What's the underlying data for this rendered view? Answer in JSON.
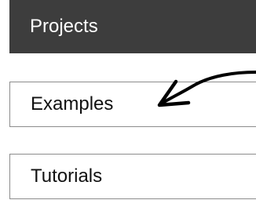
{
  "header": {
    "title": "Projects"
  },
  "items": [
    {
      "label": "Examples"
    },
    {
      "label": "Tutorials"
    }
  ],
  "colors": {
    "header_bg": "#3d3d3d",
    "header_text": "#ffffff",
    "item_border": "#8c8c8c",
    "arrow": "#000000"
  },
  "icons": {
    "annotation": "hand-drawn-arrow-icon"
  }
}
